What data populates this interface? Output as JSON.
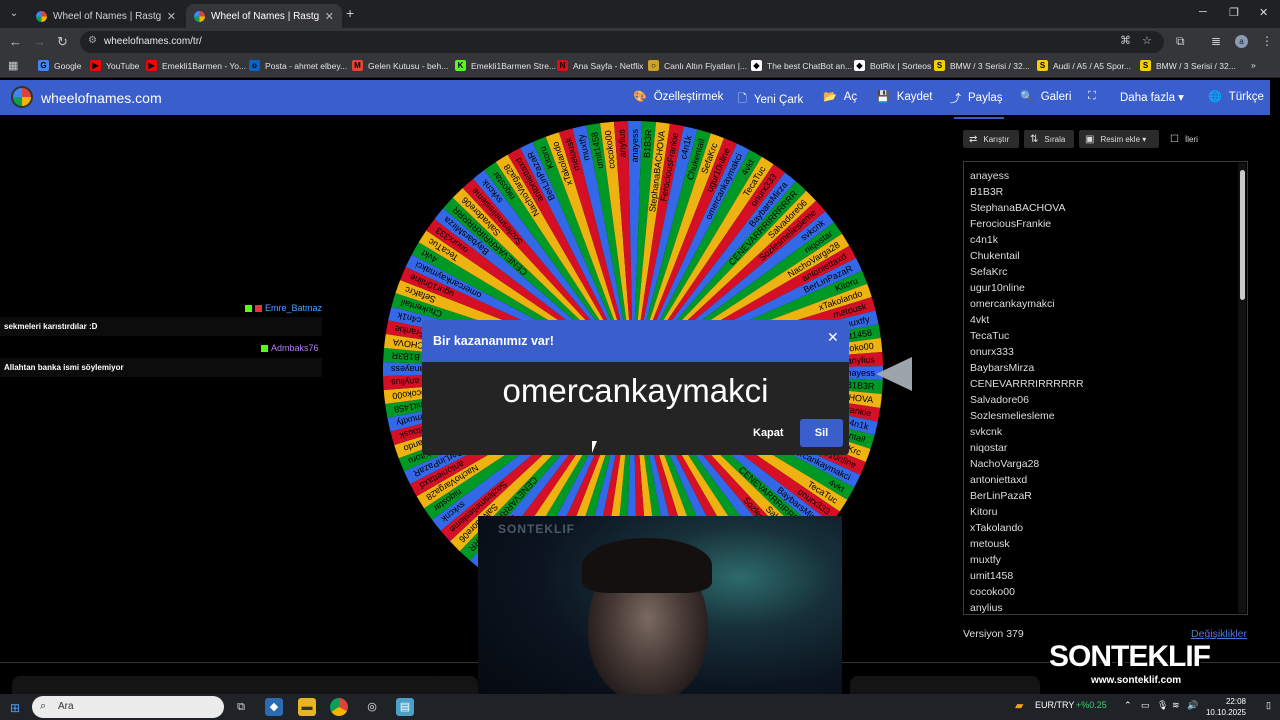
{
  "browser": {
    "tabs": [
      {
        "title": "Wheel of Names | Rastgele ad seçici",
        "active": false
      },
      {
        "title": "Wheel of Names | Rastgele ad seçici",
        "active": true
      }
    ],
    "url": "wheelofnames.com/tr/",
    "bookmarks": [
      {
        "label": "Google",
        "color": "#4285f4",
        "glyph": "G"
      },
      {
        "label": "YouTube",
        "color": "#ff0000",
        "glyph": "▶"
      },
      {
        "label": "Emekli1Barmen - Yo...",
        "color": "#ff0000",
        "glyph": "▶"
      },
      {
        "label": "Posta - ahmet elbey...",
        "color": "#0a64c8",
        "glyph": "o"
      },
      {
        "label": "Gelen Kutusu - beh...",
        "color": "#ea4335",
        "glyph": "M"
      },
      {
        "label": "Emekli1Barmen Stre...",
        "color": "#53fc18",
        "glyph": "K"
      },
      {
        "label": "Ana Sayfa - Netflix",
        "color": "#e50914",
        "glyph": "N"
      },
      {
        "label": "Canlı Altın Fiyatları |...",
        "color": "#c9a227",
        "glyph": "○"
      },
      {
        "label": "The best ChatBot an...",
        "color": "#ffffff",
        "glyph": "◆"
      },
      {
        "label": "BotRix | Sorteos",
        "color": "#ffffff",
        "glyph": "◆"
      },
      {
        "label": "BMW / 3 Serisi / 32...",
        "color": "#f5d000",
        "glyph": "S"
      },
      {
        "label": "Audi / A5 / A5 Spor...",
        "color": "#f5d000",
        "glyph": "S"
      },
      {
        "label": "BMW / 3 Serisi / 32...",
        "color": "#f5d000",
        "glyph": "S"
      }
    ]
  },
  "site": {
    "logo": "wheelofnames.com",
    "menu": [
      {
        "label": "Özelleştirmek",
        "icon": "palette-icon",
        "glyph": "🎨"
      },
      {
        "label": "Yeni Çark",
        "icon": "file-icon",
        "glyph": "🗋"
      },
      {
        "label": "Aç",
        "icon": "folder-icon",
        "glyph": "📂"
      },
      {
        "label": "Kaydet",
        "icon": "save-icon",
        "glyph": "💾"
      },
      {
        "label": "Paylaş",
        "icon": "share-icon",
        "glyph": "⤴"
      },
      {
        "label": "Galeri",
        "icon": "search-icon",
        "glyph": "🔍"
      },
      {
        "label": "",
        "icon": "fullscreen-icon",
        "glyph": "⛶"
      },
      {
        "label": "Daha fazla ▾",
        "icon": "",
        "glyph": ""
      },
      {
        "label": "Türkçe",
        "icon": "globe-icon",
        "glyph": "🌐"
      }
    ]
  },
  "chat": [
    {
      "user": "Emre_Batmaz",
      "user_color": "#4aa3ff",
      "message": "sekmeleri karıstırdılar :D"
    },
    {
      "user": "Admbaks76",
      "user_color": "#b47cff",
      "message": "Allahtan banka ismi söylemiyor"
    }
  ],
  "panel": {
    "controls": [
      {
        "label": "Karıştır",
        "icon": "shuffle-icon",
        "glyph": "⇄"
      },
      {
        "label": "Sırala",
        "icon": "sort-icon",
        "glyph": "⇅"
      },
      {
        "label": "Resim ekle ▾",
        "icon": "image-icon",
        "glyph": "▣"
      },
      {
        "label": "İleri",
        "icon": "checkbox-icon",
        "glyph": "☐"
      }
    ],
    "entries": [
      "anayess",
      "B1B3R",
      "StephanaBACHOVA",
      "FerociousFrankie",
      "c4n1k",
      "Chukentail",
      "SefaKrc",
      "ugur10nline",
      "omercankaymakci",
      "4vkt",
      "TecaTuc",
      "onurx333",
      "BaybarsMirza",
      "CENEVARRRIRRRRRR",
      "Salvadore06",
      "Sozlesmeliesleme",
      "svkcnk",
      "niqostar",
      "NachoVarga28",
      "antoniettaxd",
      "BerLinPazaR",
      "Kitoru",
      "xTakolando",
      "metousk",
      "muxtfy",
      "umit1458",
      "cocoko00",
      "anylius"
    ],
    "version": "Versiyon 379",
    "changes_link": "Değişiklikler"
  },
  "wheel": {
    "colors": [
      "#3369e8",
      "#009925",
      "#eeb211",
      "#d50f25"
    ]
  },
  "modal": {
    "title": "Bir kazananımız var!",
    "winner": "omercankaymakci",
    "close_label": "Kapat",
    "remove_label": "Sil"
  },
  "brand": {
    "name": "SONTEKLIF",
    "url": "www.sonteklif.com",
    "cam_logo": "SONTEKLIF"
  },
  "taskbar": {
    "search_placeholder": "Ara",
    "currency": "EUR/TRY",
    "change": "+%0.25",
    "time": "22:08",
    "date": "10.10.2025"
  }
}
